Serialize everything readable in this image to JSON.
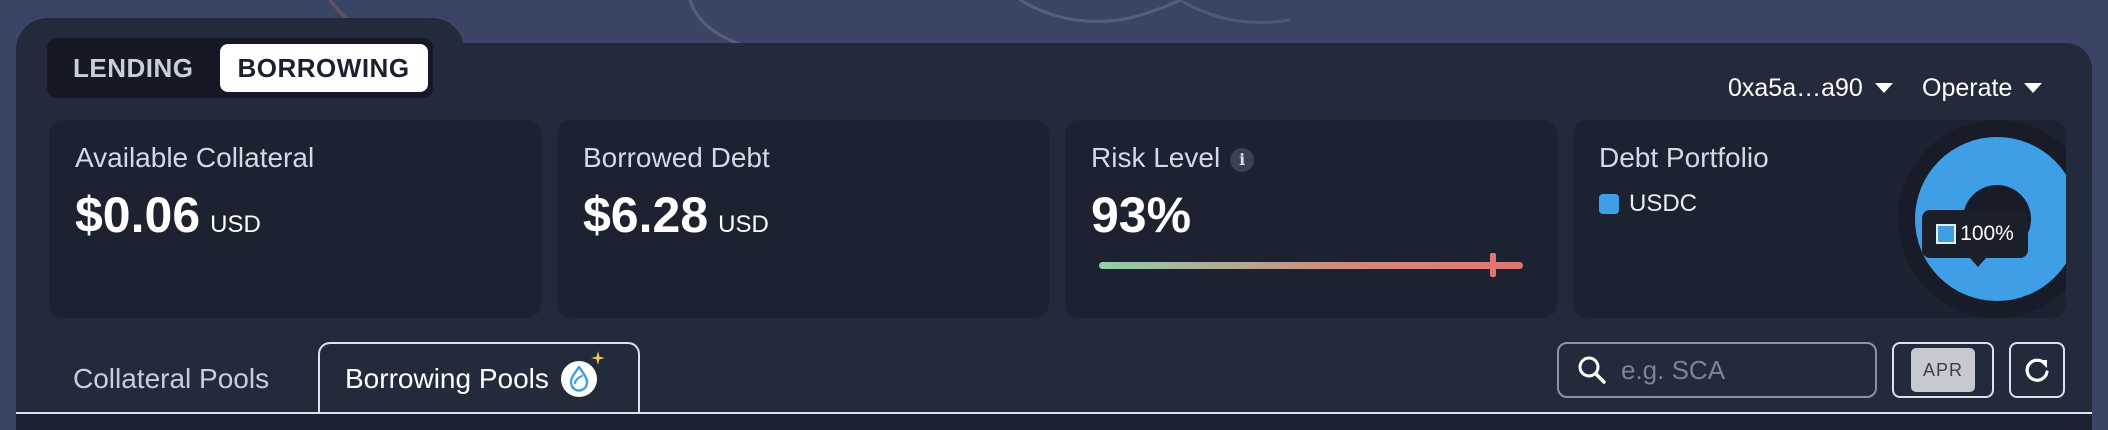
{
  "mode_tabs": {
    "lending": "LENDING",
    "borrowing": "BORROWING",
    "active": "borrowing"
  },
  "header": {
    "wallet_label": "0xa5a…a90",
    "operate_label": "Operate"
  },
  "cards": {
    "collateral": {
      "title": "Available Collateral",
      "value": "$0.06",
      "unit": "USD"
    },
    "debt": {
      "title": "Borrowed Debt",
      "value": "$6.28",
      "unit": "USD"
    },
    "risk": {
      "title": "Risk Level",
      "info_icon": "info-icon",
      "value": "93%",
      "level": 0.93
    },
    "portfolio": {
      "title": "Debt Portfolio",
      "legend": [
        {
          "label": "USDC",
          "color": "#3f9fe6"
        }
      ],
      "tooltip": "100%",
      "chart_data": {
        "type": "pie",
        "categories": [
          "USDC"
        ],
        "values": [
          100
        ]
      }
    }
  },
  "pool_tabs": {
    "collateral": "Collateral Pools",
    "borrowing": "Borrowing Pools",
    "borrowing_icon": "sui-droplet-icon"
  },
  "search": {
    "placeholder": "e.g. SCA",
    "value": ""
  },
  "apr_toggle": {
    "label": "APR"
  },
  "refresh": {
    "icon": "refresh-icon"
  },
  "colors": {
    "accent": "#3f9fe6",
    "risk_low": "#8fcfad",
    "risk_high": "#e07672"
  }
}
